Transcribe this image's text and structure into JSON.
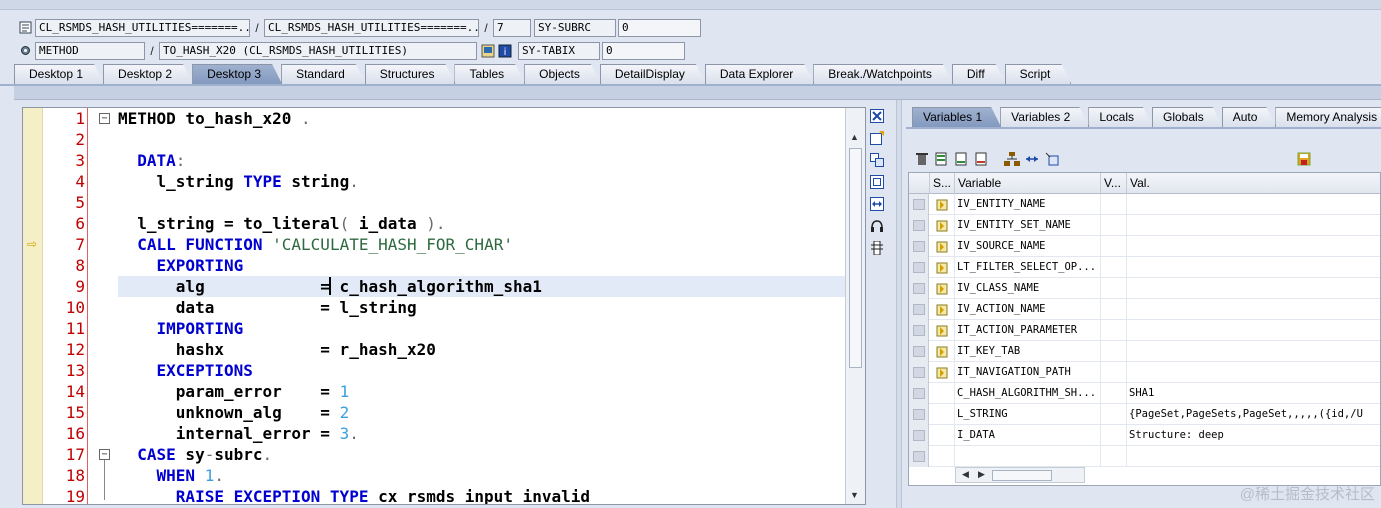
{
  "header": {
    "row1": {
      "program": "CL_RSMDS_HASH_UTILITIES=======...",
      "include": "CL_RSMDS_HASH_UTILITIES=======...",
      "line": "7",
      "sysfield": "SY-SUBRC",
      "sysvalue": "0"
    },
    "row2": {
      "event_type": "METHOD",
      "event": "TO_HASH_X20 (CL_RSMDS_HASH_UTILITIES)",
      "sysfield": "SY-TABIX",
      "sysvalue": "0"
    },
    "separator": "/"
  },
  "tabs": [
    "Desktop 1",
    "Desktop 2",
    "Desktop 3",
    "Standard",
    "Structures",
    "Tables",
    "Objects",
    "DetailDisplay",
    "Data Explorer",
    "Break./Watchpoints",
    "Diff",
    "Script"
  ],
  "active_tab": "Desktop 3",
  "editor": {
    "current_line": 7,
    "lines": [
      {
        "n": "1",
        "segs": [
          {
            "t": "METHOD to_hash_x20 ",
            "c": ""
          },
          {
            "t": ".",
            "c": "op"
          }
        ]
      },
      {
        "n": "2",
        "segs": []
      },
      {
        "n": "3",
        "segs": [
          {
            "t": "  ",
            "c": ""
          },
          {
            "t": "DATA",
            "c": "kw"
          },
          {
            "t": ":",
            "c": "op"
          }
        ]
      },
      {
        "n": "4",
        "segs": [
          {
            "t": "    l_string ",
            "c": ""
          },
          {
            "t": "TYPE",
            "c": "kw"
          },
          {
            "t": " string",
            "c": ""
          },
          {
            "t": ".",
            "c": "op"
          }
        ]
      },
      {
        "n": "5",
        "segs": []
      },
      {
        "n": "6",
        "segs": [
          {
            "t": "  l_string = to_literal",
            "c": ""
          },
          {
            "t": "(",
            "c": "op"
          },
          {
            "t": " i_data ",
            "c": ""
          },
          {
            "t": ").",
            "c": "op"
          }
        ]
      },
      {
        "n": "7",
        "segs": [
          {
            "t": "  ",
            "c": ""
          },
          {
            "t": "CALL FUNCTION",
            "c": "kw"
          },
          {
            "t": " ",
            "c": ""
          },
          {
            "t": "'CALCULATE_HASH_FOR_CHAR'",
            "c": "str"
          }
        ]
      },
      {
        "n": "8",
        "segs": [
          {
            "t": "    ",
            "c": ""
          },
          {
            "t": "EXPORTING",
            "c": "kw"
          }
        ]
      },
      {
        "n": "9",
        "segs": [
          {
            "t": "      alg            = c_hash_algorithm_sha1",
            "c": ""
          }
        ]
      },
      {
        "n": "10",
        "segs": [
          {
            "t": "      data           = l_string",
            "c": ""
          }
        ]
      },
      {
        "n": "11",
        "segs": [
          {
            "t": "    ",
            "c": ""
          },
          {
            "t": "IMPORTING",
            "c": "kw"
          }
        ]
      },
      {
        "n": "12",
        "segs": [
          {
            "t": "      hashx          = r_hash_x20",
            "c": ""
          }
        ]
      },
      {
        "n": "13",
        "segs": [
          {
            "t": "    ",
            "c": ""
          },
          {
            "t": "EXCEPTIONS",
            "c": "kw"
          }
        ]
      },
      {
        "n": "14",
        "segs": [
          {
            "t": "      param_error    = ",
            "c": ""
          },
          {
            "t": "1",
            "c": "num"
          }
        ]
      },
      {
        "n": "15",
        "segs": [
          {
            "t": "      unknown_alg    = ",
            "c": ""
          },
          {
            "t": "2",
            "c": "num"
          }
        ]
      },
      {
        "n": "16",
        "segs": [
          {
            "t": "      internal_error = ",
            "c": ""
          },
          {
            "t": "3",
            "c": "num"
          },
          {
            "t": ".",
            "c": "op"
          }
        ]
      },
      {
        "n": "17",
        "segs": [
          {
            "t": "  ",
            "c": ""
          },
          {
            "t": "CASE",
            "c": "kw"
          },
          {
            "t": " sy",
            "c": ""
          },
          {
            "t": "-",
            "c": "op"
          },
          {
            "t": "subrc",
            "c": ""
          },
          {
            "t": ".",
            "c": "op"
          }
        ]
      },
      {
        "n": "18",
        "segs": [
          {
            "t": "    ",
            "c": ""
          },
          {
            "t": "WHEN",
            "c": "kw"
          },
          {
            "t": " ",
            "c": ""
          },
          {
            "t": "1",
            "c": "num"
          },
          {
            "t": ".",
            "c": "op"
          }
        ]
      },
      {
        "n": "19",
        "segs": [
          {
            "t": "      ",
            "c": ""
          },
          {
            "t": "RAISE EXCEPTION TYPE",
            "c": "kw"
          },
          {
            "t": " cx_rsmds_input_invalid",
            "c": ""
          }
        ]
      }
    ]
  },
  "right_tabs": [
    "Variables 1",
    "Variables 2",
    "Locals",
    "Globals",
    "Auto",
    "Memory Analysis"
  ],
  "right_active_tab": "Variables 1",
  "variables": {
    "columns": [
      "S...",
      "Variable",
      "V...",
      "Val."
    ],
    "rows": [
      {
        "name": "IV_ENTITY_NAME",
        "value": "",
        "icon": true
      },
      {
        "name": "IV_ENTITY_SET_NAME",
        "value": "",
        "icon": true
      },
      {
        "name": "IV_SOURCE_NAME",
        "value": "",
        "icon": true
      },
      {
        "name": "LT_FILTER_SELECT_OP...",
        "value": "",
        "icon": true
      },
      {
        "name": "IV_CLASS_NAME",
        "value": "",
        "icon": true
      },
      {
        "name": "IV_ACTION_NAME",
        "value": "",
        "icon": true
      },
      {
        "name": "IT_ACTION_PARAMETER",
        "value": "",
        "icon": true
      },
      {
        "name": "IT_KEY_TAB",
        "value": "",
        "icon": true
      },
      {
        "name": "IT_NAVIGATION_PATH",
        "value": "",
        "icon": true
      },
      {
        "name": "C_HASH_ALGORITHM_SH...",
        "value": "SHA1",
        "icon": false
      },
      {
        "name": "L_STRING",
        "value": "{PageSet,PageSets,PageSet,,,,,({id,/U",
        "icon": false
      },
      {
        "name": "I_DATA",
        "value": "Structure: deep",
        "icon": false
      },
      {
        "name": "",
        "value": "",
        "icon": false
      }
    ]
  },
  "watermark": "@稀土掘金技术社区"
}
